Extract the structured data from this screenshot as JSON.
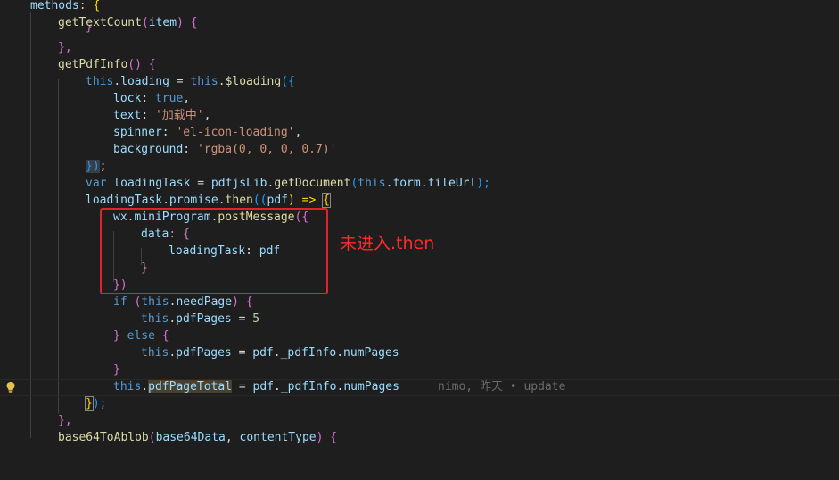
{
  "code": {
    "l1": {
      "a": "methods",
      "b": ": {"
    },
    "l2": {
      "a": "getTextCount",
      "b": "(",
      "c": "item",
      "d": ") {"
    },
    "l3": {
      "a": "}"
    },
    "l4": {
      "a": "},"
    },
    "l5": {
      "a": "getPdfInfo",
      "b": "() {"
    },
    "l6": {
      "a": "this",
      "b": ".",
      "c": "loading",
      "d": " = ",
      "e": "this",
      "f": ".",
      "g": "$loading",
      "h": "({"
    },
    "l7": {
      "a": "lock",
      "b": ": ",
      "c": "true",
      "d": ","
    },
    "l8": {
      "a": "text",
      "b": ": ",
      "c": "'加载中'",
      "d": ","
    },
    "l9": {
      "a": "spinner",
      "b": ": ",
      "c": "'el-icon-loading'",
      "d": ","
    },
    "l10": {
      "a": "background",
      "b": ": ",
      "c": "'rgba(0, 0, 0, 0.7)'"
    },
    "l11": {
      "a": "})",
      "b": ";"
    },
    "l12": {
      "a": "var",
      "b": " ",
      "c": "loadingTask",
      "d": " = ",
      "e": "pdfjsLib",
      "f": ".",
      "g": "getDocument",
      "h": "(",
      "i": "this",
      "j": ".",
      "k": "form",
      "l": ".",
      "m": "fileUrl",
      "n": ");"
    },
    "l13": {
      "a": "loadingTask",
      "b": ".",
      "c": "promise",
      "d": ".",
      "e": "then",
      "f": "((",
      "g": "pdf",
      "h": ") => ",
      "i": "{"
    },
    "l14": {
      "a": "wx",
      "b": ".",
      "c": "miniProgram",
      "d": ".",
      "e": "postMessage",
      "f": "({"
    },
    "l15": {
      "a": "data",
      "b": ": {"
    },
    "l16": {
      "a": "loadingTask",
      "b": ": ",
      "c": "pdf"
    },
    "l17": {
      "a": "}"
    },
    "l18": {
      "a": "})"
    },
    "l19": {
      "a": "if",
      "b": " (",
      "c": "this",
      "d": ".",
      "e": "needPage",
      "f": ") {"
    },
    "l20": {
      "a": "this",
      "b": ".",
      "c": "pdfPages",
      "d": " = ",
      "e": "5"
    },
    "l21": {
      "a": "}",
      "b": " ",
      "c": "else",
      "d": " {"
    },
    "l22": {
      "a": "this",
      "b": ".",
      "c": "pdfPages",
      "d": " = ",
      "e": "pdf",
      "f": ".",
      "g": "_pdfInfo",
      "h": ".",
      "i": "numPages"
    },
    "l23": {
      "a": "}"
    },
    "l24": {
      "a": "this",
      "b": ".",
      "c": "pdfPageTotal",
      "d": " = ",
      "e": "pdf",
      "f": ".",
      "g": "_pdfInfo",
      "h": ".",
      "i": "numPages"
    },
    "l25": {
      "a": "}",
      "b": ");"
    },
    "l26": {
      "a": "},"
    },
    "l27": {
      "a": "base64ToAblob",
      "b": "(",
      "c": "base64Data",
      "d": ", ",
      "e": "contentType",
      "f": ") {"
    }
  },
  "blame": "nimo, 昨天 • update",
  "annotation": "未进入.then",
  "colors": {
    "background": "#1e1e1e",
    "keyword": "#569cd6",
    "function": "#dcdcaa",
    "variable": "#9cdcfe",
    "string": "#ce9178",
    "annotation": "#ff2b2b"
  },
  "icons": {
    "gutter": "lightbulb-icon"
  }
}
